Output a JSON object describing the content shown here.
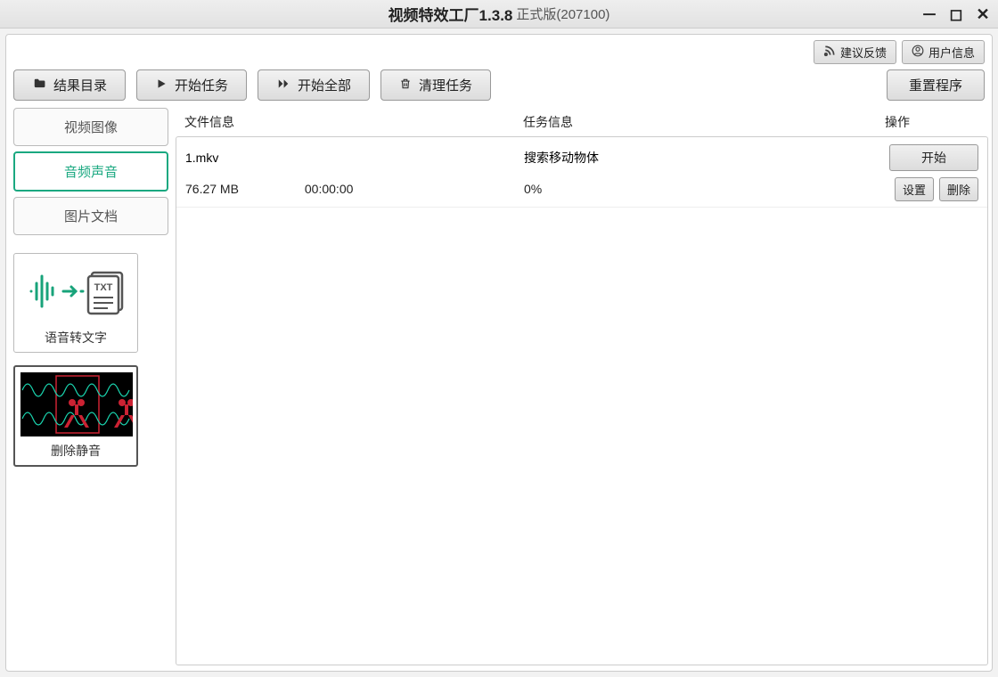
{
  "window": {
    "title_main": "视频特效工厂1.3.8",
    "title_sub": "正式版(207100)"
  },
  "top_actions": {
    "feedback": "建议反馈",
    "user_info": "用户信息"
  },
  "toolbar": {
    "result_dir": "结果目录",
    "start_task": "开始任务",
    "start_all": "开始全部",
    "clear_tasks": "清理任务",
    "reset_program": "重置程序"
  },
  "sidebar": {
    "tabs": {
      "video_image": "视频图像",
      "audio_sound": "音频声音",
      "picture_doc": "图片文档"
    },
    "tools": {
      "speech_to_text": "语音转文字",
      "remove_silence": "删除静音"
    }
  },
  "table": {
    "headers": {
      "file_info": "文件信息",
      "task_info": "任务信息",
      "ops": "操作"
    },
    "rows": [
      {
        "filename": "1.mkv",
        "task_name": "搜索移动物体",
        "size": "76.27 MB",
        "duration": "00:00:00",
        "progress": "0%",
        "start": "开始",
        "settings": "设置",
        "delete": "删除"
      }
    ]
  }
}
